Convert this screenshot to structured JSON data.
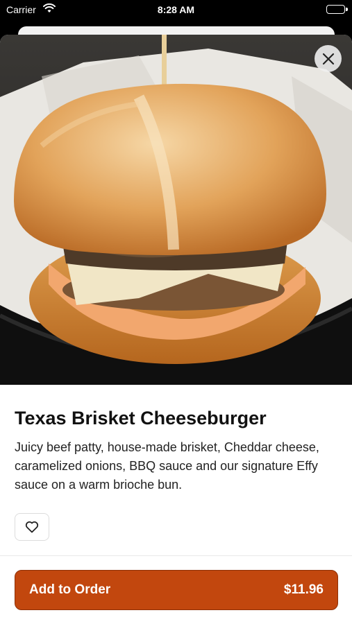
{
  "status_bar": {
    "carrier": "Carrier",
    "time": "8:28 AM",
    "wifi_icon": "wifi-icon",
    "battery_icon": "battery-icon"
  },
  "item": {
    "name": "Texas Brisket Cheeseburger",
    "description": "Juicy beef patty, house-made brisket, Cheddar cheese, caramelized onions, BBQ sauce and our signature Effy sauce on a warm brioche bun.",
    "photo_subject": "brisket cheeseburger in paper-lined black basket"
  },
  "actions": {
    "close_icon": "close-icon",
    "favorite_icon": "heart-outline-icon",
    "add_label": "Add to Order",
    "price": "$11.96"
  },
  "colors": {
    "accent": "#c2470e",
    "accent_border": "#8e2f06",
    "text_primary": "#111111",
    "sheet_background": "#ffffff"
  }
}
